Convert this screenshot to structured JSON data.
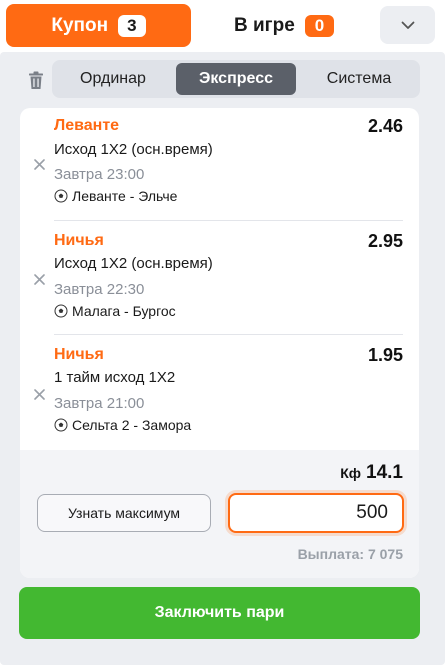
{
  "tabs": {
    "coupon": {
      "label": "Купон",
      "count": "3"
    },
    "ingame": {
      "label": "В игре",
      "count": "0"
    }
  },
  "icons": {
    "collapse": "chevron-down-icon",
    "trash": "trash-icon",
    "remove": "close-icon",
    "sport": "soccer-ball-icon"
  },
  "bet_types": {
    "items": [
      "Ординар",
      "Экспресс",
      "Система"
    ],
    "selected": "Экспресс"
  },
  "bets": [
    {
      "outcome": "Леванте",
      "odds": "2.46",
      "market": "Исход 1X2 (осн.время)",
      "time": "Завтра 23:00",
      "match": "Леванте - Эльче"
    },
    {
      "outcome": "Ничья",
      "odds": "2.95",
      "market": "Исход 1X2 (осн.время)",
      "time": "Завтра 22:30",
      "match": "Малага - Бургос"
    },
    {
      "outcome": "Ничья",
      "odds": "1.95",
      "market": "1 тайм исход 1X2",
      "time": "Завтра 21:00",
      "match": "Сельта 2 - Замора"
    }
  ],
  "summary": {
    "coef_label": "Кф",
    "coef_value": "14.1",
    "max_button": "Узнать максимум",
    "stake": "500",
    "payout": "Выплата: 7 075"
  },
  "place_button": "Заключить пари",
  "colors": {
    "accent": "#ff6a13",
    "confirm": "#43b831",
    "panel": "#eceef2",
    "segment_active": "#5b6069"
  }
}
